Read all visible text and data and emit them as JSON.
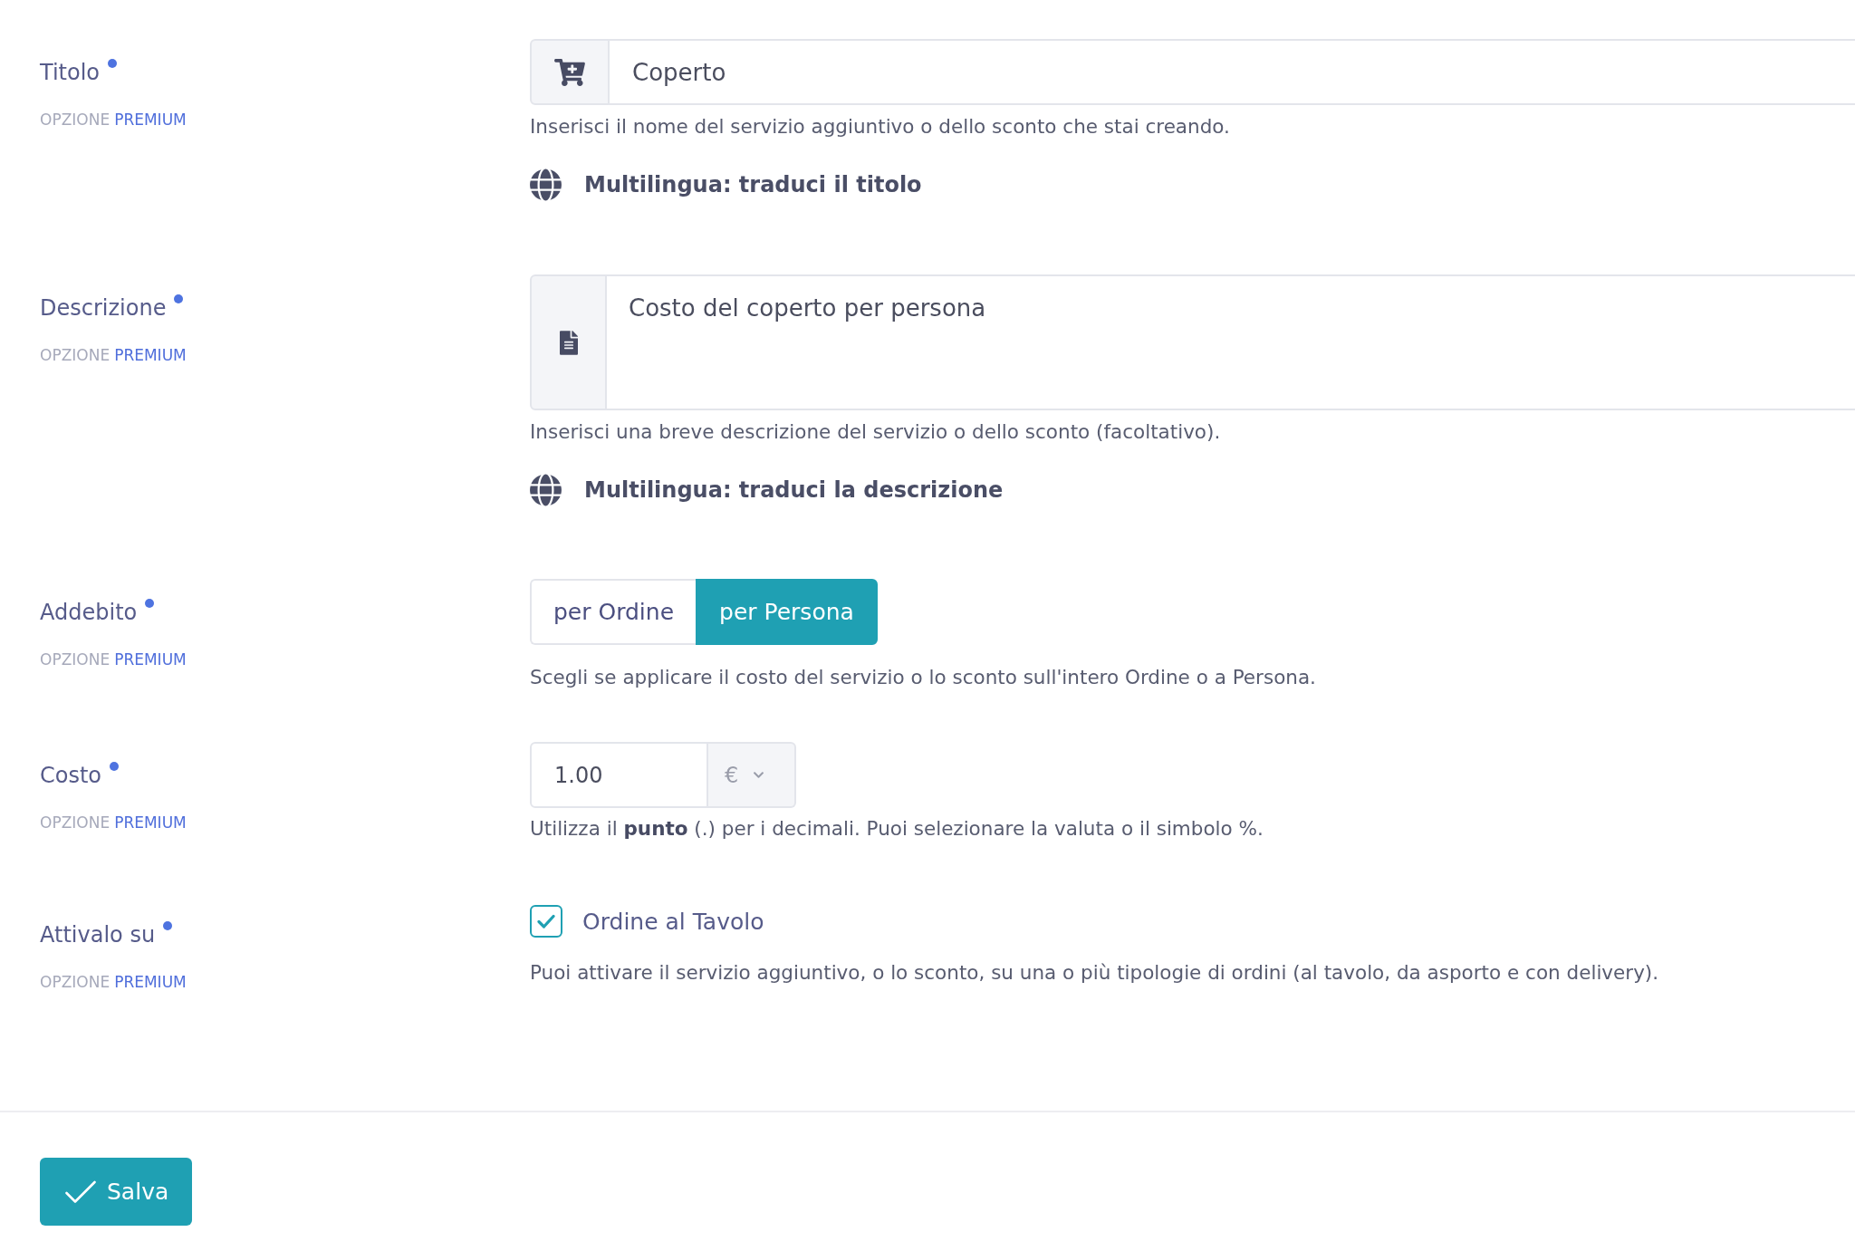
{
  "form": {
    "fields": [
      {
        "kind": "input",
        "label": "Titolo",
        "required": true,
        "option": "OPZIONE",
        "tier": "PREMIUM",
        "value": "Coperto",
        "help": "Inserisci il nome del servizio aggiuntivo o dello sconto che stai creando.",
        "translate": "Multilingua: traduci il titolo"
      },
      {
        "kind": "textarea",
        "label": "Descrizione",
        "required": true,
        "option": "OPZIONE",
        "tier": "PREMIUM",
        "value": "Costo del coperto per persona",
        "help": "Inserisci una breve descrizione del servizio o dello sconto (facoltativo).",
        "translate": "Multilingua: traduci la descrizione"
      },
      {
        "kind": "segmented",
        "label": "Addebito",
        "required": true,
        "option": "OPZIONE",
        "tier": "PREMIUM",
        "options": [
          {
            "label": "per Ordine",
            "selected": false
          },
          {
            "label": "per Persona",
            "selected": true
          }
        ],
        "help": "Scegli se applicare il costo del servizio o lo sconto sull'intero Ordine o a Persona."
      },
      {
        "kind": "currency",
        "label": "Costo",
        "required": true,
        "option": "OPZIONE",
        "tier": "PREMIUM",
        "value": "1.00",
        "currency": "€",
        "help": "Utilizza il **punto** (.) per i decimali. Puoi selezionare la valuta o il simbolo %."
      },
      {
        "kind": "checklist",
        "label": "Attivalo su",
        "required": true,
        "option": "OPZIONE",
        "tier": "PREMIUM",
        "options": [
          {
            "label": "Ordine al Tavolo",
            "checked": true
          }
        ],
        "help": "Puoi attivare il servizio aggiuntivo, o lo sconto, su una o più tipologie di ordini (al tavolo, da asporto e con delivery)."
      }
    ]
  },
  "footer": {
    "save_button": "Salva"
  }
}
